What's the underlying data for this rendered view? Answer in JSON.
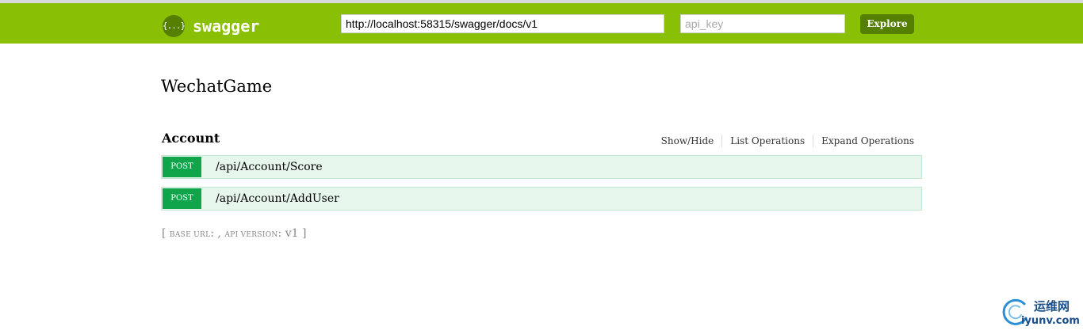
{
  "header": {
    "logo_glyph": "{...}",
    "brand": "swagger",
    "url_value": "http://localhost:58315/swagger/docs/v1",
    "api_key_placeholder": "api_key",
    "explore_label": "Explore",
    "colors": {
      "header_bg": "#89bf04",
      "button_bg": "#547f00"
    }
  },
  "info": {
    "title": "WechatGame"
  },
  "resource": {
    "name": "Account",
    "operations_links": [
      "Show/Hide",
      "List Operations",
      "Expand Operations"
    ],
    "endpoints": [
      {
        "method": "POST",
        "path": "/api/Account/Score"
      },
      {
        "method": "POST",
        "path": "/api/Account/AddUser"
      }
    ],
    "colors": {
      "post_method": "#10a54a",
      "post_row_bg": "#e7f6ec"
    }
  },
  "footer": {
    "open_bracket": "[",
    "base_url_label": "BASE URL",
    "base_url_sep": ":",
    "base_url_value": ",",
    "api_version_label": "API VERSION",
    "api_version_sep": ":",
    "api_version_value": "v1",
    "close_bracket": "]"
  },
  "watermark": {
    "text_cn": "运维网",
    "text_url": "iyunv.com"
  }
}
